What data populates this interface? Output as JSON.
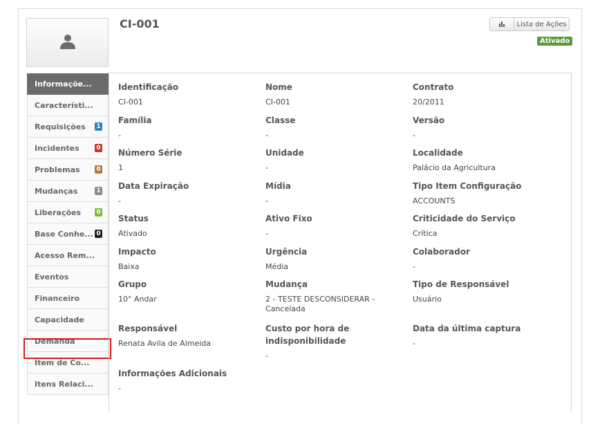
{
  "header": {
    "title": "CI-001",
    "actions_label": "Lista de Ações",
    "status_badge": "Ativado",
    "colors": {
      "badge": "#5a9a3c",
      "active_nav": "#6b6b6b",
      "highlight": "#d4161b"
    }
  },
  "sidebar": {
    "items": [
      {
        "label": "Informaçõe...",
        "active": true
      },
      {
        "label": "Característi..."
      },
      {
        "label": "Requisições",
        "count": "1",
        "count_color": "#2a84c4"
      },
      {
        "label": "Incidentes",
        "count": "0",
        "count_color": "#c0392b"
      },
      {
        "label": "Problemas",
        "count": "0",
        "count_color": "#b8763a"
      },
      {
        "label": "Mudanças",
        "count": "1",
        "count_color": "#8a8a8a"
      },
      {
        "label": "Liberações",
        "count": "0",
        "count_color": "#7dbb3d"
      },
      {
        "label": "Base Conhe...",
        "count": "0",
        "count_color": "#222222"
      },
      {
        "label": "Acesso Rem..."
      },
      {
        "label": "Eventos"
      },
      {
        "label": "Financeiro"
      },
      {
        "label": "Capacidade"
      },
      {
        "label": "Demanda"
      },
      {
        "label": "Item de Co..."
      },
      {
        "label": "Itens Relaci..."
      }
    ]
  },
  "fields": {
    "identificacao": {
      "label": "Identificação",
      "value": "CI-001"
    },
    "nome": {
      "label": "Nome",
      "value": "CI-001"
    },
    "contrato": {
      "label": "Contrato",
      "value": "20/2011"
    },
    "familia": {
      "label": "Família",
      "value": "-"
    },
    "classe": {
      "label": "Classe",
      "value": "-"
    },
    "versao": {
      "label": "Versão",
      "value": "-"
    },
    "numero_serie": {
      "label": "Número Série",
      "value": "1"
    },
    "unidade": {
      "label": "Unidade",
      "value": "-"
    },
    "localidade": {
      "label": "Localidade",
      "value": "Palácio da Agricultura"
    },
    "data_expiracao": {
      "label": "Data Expiração",
      "value": "-"
    },
    "midia": {
      "label": "Mídia",
      "value": "-"
    },
    "tipo_item": {
      "label": "Tipo Item Configuração",
      "value": "ACCOUNTS"
    },
    "status": {
      "label": "Status",
      "value": "Ativado"
    },
    "ativo_fixo": {
      "label": "Ativo Fixo",
      "value": "-"
    },
    "criticidade": {
      "label": "Criticidade do Serviço",
      "value": "Crítica"
    },
    "impacto": {
      "label": "Impacto",
      "value": "Baixa"
    },
    "urgencia": {
      "label": "Urgência",
      "value": "Média"
    },
    "colaborador": {
      "label": "Colaborador",
      "value": "-"
    },
    "grupo": {
      "label": "Grupo",
      "value": "10° Andar"
    },
    "mudanca": {
      "label": "Mudança",
      "value": "2 - TESTE DESCONSIDERAR - Cancelada"
    },
    "tipo_responsavel": {
      "label": "Tipo de Responsável",
      "value": "Usuário"
    },
    "responsavel": {
      "label": "Responsável",
      "value": "Renata Avila de Almeida"
    },
    "custo_hora": {
      "label": "Custo por hora de indisponibilidade",
      "value": "-"
    },
    "data_captura": {
      "label": "Data da última captura",
      "value": "-"
    },
    "info_adicionais": {
      "label": "Informações Adicionais",
      "value": "-"
    }
  }
}
